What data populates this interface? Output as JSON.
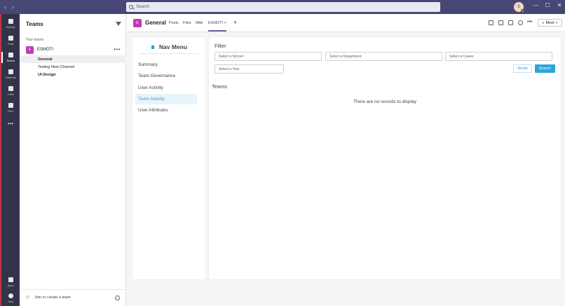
{
  "titlebar": {
    "back_icon": "chevron-left-icon",
    "forward_icon": "chevron-right-icon",
    "search_placeholder": "Search",
    "user_initial": "S",
    "minimize": "—",
    "maximize": "☐",
    "close": "✕"
  },
  "rail": {
    "items": [
      {
        "label": "Activity",
        "icon": "bell-icon"
      },
      {
        "label": "Chat",
        "icon": "chat-icon"
      },
      {
        "label": "Teams",
        "icon": "teams-icon"
      },
      {
        "label": "Calendar",
        "icon": "calendar-icon"
      },
      {
        "label": "Calls",
        "icon": "phone-icon"
      },
      {
        "label": "Files",
        "icon": "file-icon"
      }
    ],
    "more": "•••",
    "apps": "Apps",
    "help": "Help"
  },
  "panel": {
    "title": "Teams",
    "section": "Your teams",
    "team": {
      "initial": "E",
      "name": "ESMOTI",
      "more": "•••"
    },
    "channels": [
      {
        "name": "General",
        "active": true
      },
      {
        "name": "Testing New Channel",
        "active": false
      },
      {
        "name": "UI-Design",
        "active": false
      }
    ],
    "join": "Join or create a team"
  },
  "header": {
    "initial": "E",
    "channel": "General",
    "tabs": [
      "Posts",
      "Files",
      "Wiki",
      "ESMOTI"
    ],
    "active_tab": "ESMOTI",
    "add": "+",
    "meet": "Meet"
  },
  "nav": {
    "title": "Nav Menu",
    "items": [
      "Summary",
      "Team Governance",
      "User Activity",
      "Team Activity",
      "User Attributes"
    ],
    "active": "Team Activity"
  },
  "filter": {
    "title": "Filter",
    "school": "Select a School",
    "department": "Select a Department",
    "career": "Select a Career",
    "year": "Select a Year",
    "reset": "Reset",
    "search": "Search"
  },
  "teams_section": {
    "title": "Teams",
    "empty": "There are no records to display"
  },
  "colors": {
    "titlebar": "#464775",
    "rail": "#33344a",
    "accent": "#2aa6d9",
    "team_avatar": "#c239b3"
  }
}
